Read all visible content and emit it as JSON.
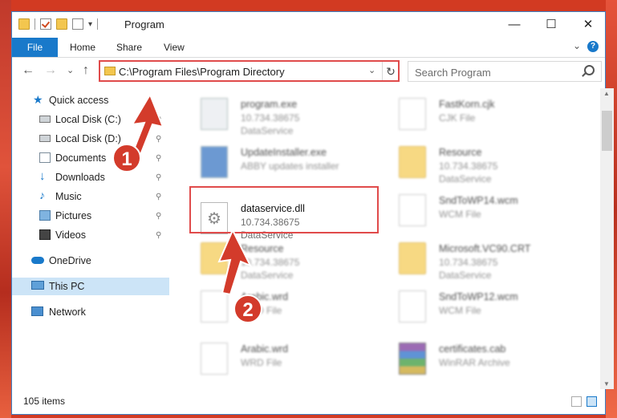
{
  "window": {
    "title": "Program",
    "controls": {
      "minimize": "—",
      "maximize": "☐",
      "close": "✕"
    }
  },
  "ribbon": {
    "tabs": [
      "File",
      "Home",
      "Share",
      "View"
    ]
  },
  "address": {
    "path": "C:\\Program Files\\Program Directory",
    "refresh": "↻",
    "dropdown": "⌄"
  },
  "search": {
    "placeholder": "Search Program"
  },
  "nav": {
    "back": "←",
    "forward": "→",
    "recent": "⌄",
    "up": "↑"
  },
  "sidebar": {
    "items": [
      {
        "label": "Quick access",
        "icon": "star-icon",
        "pinned": false
      },
      {
        "label": "Local Disk (C:)",
        "icon": "drive-icon",
        "pinned": true
      },
      {
        "label": "Local Disk (D:)",
        "icon": "drive-icon",
        "pinned": true
      },
      {
        "label": "Documents",
        "icon": "documents-icon",
        "pinned": true
      },
      {
        "label": "Downloads",
        "icon": "download-icon",
        "pinned": true
      },
      {
        "label": "Music",
        "icon": "music-icon",
        "pinned": true
      },
      {
        "label": "Pictures",
        "icon": "pictures-icon",
        "pinned": true
      },
      {
        "label": "Videos",
        "icon": "videos-icon",
        "pinned": true
      },
      {
        "label": "OneDrive",
        "icon": "cloud-icon",
        "pinned": false
      },
      {
        "label": "This PC",
        "icon": "computer-icon",
        "pinned": false,
        "selected": true
      },
      {
        "label": "Network",
        "icon": "network-icon",
        "pinned": false
      }
    ],
    "pin_glyph": "📌"
  },
  "files": [
    {
      "name": "program.exe",
      "line2": "10.734.38675",
      "line3": "DataService",
      "icon": "exe-icon"
    },
    {
      "name": "FastKorn.cjk",
      "line2": "CJK File",
      "line3": "",
      "icon": "document-icon"
    },
    {
      "name": "UpdateInstaller.exe",
      "line2": "ABBY updates installer",
      "line3": "",
      "icon": "installer-icon"
    },
    {
      "name": "Resource",
      "line2": "10.734.38675",
      "line3": "DataService",
      "icon": "folder-icon"
    },
    {
      "name": "dataservice.dll",
      "line2": "10.734.38675",
      "line3": "DataService",
      "icon": "dll-gear-icon"
    },
    {
      "name": "SndToWP14.wcm",
      "line2": "WCM File",
      "line3": "",
      "icon": "document-icon"
    },
    {
      "name": "Resource",
      "line2": "10.734.38675",
      "line3": "DataService",
      "icon": "folder-icon"
    },
    {
      "name": "Microsoft.VC90.CRT",
      "line2": "10.734.38675",
      "line3": "DataService",
      "icon": "folder-icon"
    },
    {
      "name": "Arabic.wrd",
      "line2": "WRD File",
      "line3": "",
      "icon": "document-icon"
    },
    {
      "name": "SndToWP12.wcm",
      "line2": "WCM File",
      "line3": "",
      "icon": "document-icon"
    },
    {
      "name": "Arabic.wrd",
      "line2": "WRD File",
      "line3": "",
      "icon": "document-icon"
    },
    {
      "name": "certificates.cab",
      "line2": "WinRAR Archive",
      "line3": "",
      "icon": "winrar-icon"
    }
  ],
  "status": {
    "item_count": "105 items"
  },
  "callouts": {
    "step1": "1",
    "step2": "2"
  },
  "colors": {
    "accent": "#1979ca",
    "highlight": "#e04b4b",
    "badge": "#d33b2b"
  }
}
